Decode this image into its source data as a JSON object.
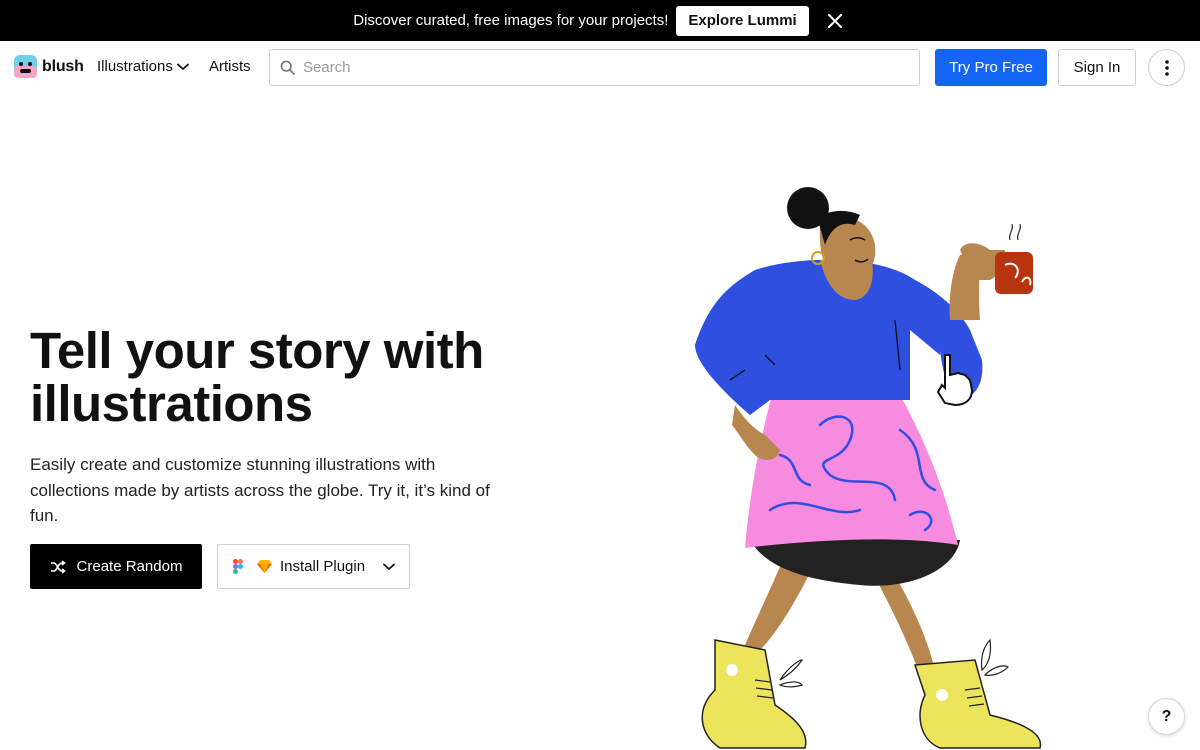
{
  "promo": {
    "text": "Discover curated, free images for your projects!",
    "button": "Explore Lummi",
    "close_icon": "close-icon"
  },
  "header": {
    "brand": "blush",
    "nav_illustrations": "Illustrations",
    "nav_artists": "Artists",
    "search_placeholder": "Search",
    "try_pro": "Try Pro Free",
    "sign_in": "Sign In",
    "more_icon": "vertical-dots-icon"
  },
  "hero": {
    "title": "Tell your story with illustrations",
    "subtitle": "Easily create and customize stunning illustrations with collections made by artists across the globe. Try it, it’s kind of fun.",
    "create_random": "Create Random",
    "install_plugin": "Install Plugin"
  },
  "help": {
    "label": "?"
  },
  "colors": {
    "primary": "#1565f5",
    "banner_bg": "#000000",
    "shirt": "#2f4fe0",
    "skirt": "#f78be0",
    "skin": "#b8864f",
    "boots": "#ece45a",
    "mug": "#b8340f"
  }
}
